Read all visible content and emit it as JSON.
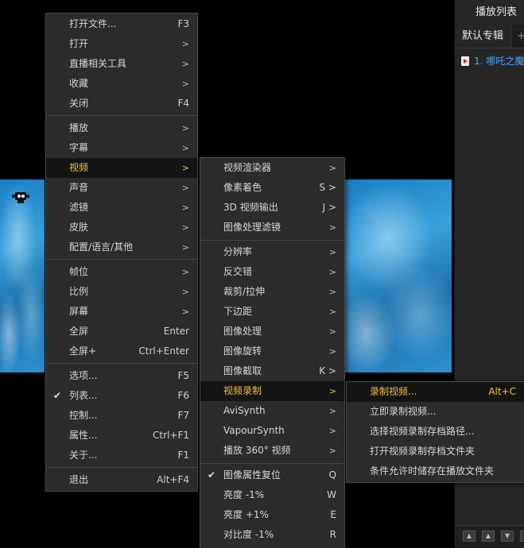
{
  "playlist": {
    "title": "播放列表",
    "tab_default": "默认专辑",
    "tab_add": "+",
    "item": "1. 哪吒之魔",
    "footer_buttons": [
      "top-arrow-icon",
      "up-arrow-icon",
      "down-arrow-icon",
      "bottom-arrow-icon"
    ]
  },
  "main_menu": [
    {
      "label": "打开文件...",
      "shortcut": "F3",
      "sub": false
    },
    {
      "label": "打开",
      "shortcut": ">",
      "sub": true
    },
    {
      "label": "直播相关工具",
      "shortcut": ">",
      "sub": true
    },
    {
      "label": "收藏",
      "shortcut": ">",
      "sub": true
    },
    {
      "label": "关闭",
      "shortcut": "F4",
      "sub": false
    },
    {
      "label": "播放",
      "shortcut": ">",
      "sub": true
    },
    {
      "label": "字幕",
      "shortcut": ">",
      "sub": true
    },
    {
      "label": "视频",
      "shortcut": ">",
      "sub": true
    },
    {
      "label": "声音",
      "shortcut": ">",
      "sub": true
    },
    {
      "label": "滤镜",
      "shortcut": ">",
      "sub": true
    },
    {
      "label": "皮肤",
      "shortcut": ">",
      "sub": true
    },
    {
      "label": "配置/语言/其他",
      "shortcut": ">",
      "sub": true
    },
    {
      "label": "帧位",
      "shortcut": ">",
      "sub": true
    },
    {
      "label": "比例",
      "shortcut": ">",
      "sub": true
    },
    {
      "label": "屏幕",
      "shortcut": ">",
      "sub": true
    },
    {
      "label": "全屏",
      "shortcut": "Enter",
      "sub": false
    },
    {
      "label": "全屏+",
      "shortcut": "Ctrl+Enter",
      "sub": false
    },
    {
      "label": "选项...",
      "shortcut": "F5",
      "sub": false
    },
    {
      "label": "列表...",
      "shortcut": "F6",
      "sub": false,
      "checked": true
    },
    {
      "label": "控制...",
      "shortcut": "F7",
      "sub": false
    },
    {
      "label": "属性...",
      "shortcut": "Ctrl+F1",
      "sub": false
    },
    {
      "label": "关于...",
      "shortcut": "F1",
      "sub": false
    },
    {
      "label": "退出",
      "shortcut": "Alt+F4",
      "sub": false
    }
  ],
  "video_menu": [
    {
      "label": "视频渲染器",
      "shortcut": ">"
    },
    {
      "label": "像素着色",
      "shortcut": "S >"
    },
    {
      "label": "3D 视频输出",
      "shortcut": "J >"
    },
    {
      "label": "图像处理滤镜",
      "shortcut": ">"
    },
    {
      "label": "分辨率",
      "shortcut": ">"
    },
    {
      "label": "反交错",
      "shortcut": ">"
    },
    {
      "label": "裁剪/拉伸",
      "shortcut": ">"
    },
    {
      "label": "下边距",
      "shortcut": ">"
    },
    {
      "label": "图像处理",
      "shortcut": ">"
    },
    {
      "label": "图像旋转",
      "shortcut": ">"
    },
    {
      "label": "图像截取",
      "shortcut": "K >"
    },
    {
      "label": "视频录制",
      "shortcut": ">"
    },
    {
      "label": "AviSynth",
      "shortcut": ">"
    },
    {
      "label": "VapourSynth",
      "shortcut": ">"
    },
    {
      "label": "播放 360° 视频",
      "shortcut": ">"
    },
    {
      "label": "图像属性复位",
      "shortcut": "Q",
      "checked": true
    },
    {
      "label": "亮度 -1%",
      "shortcut": "W"
    },
    {
      "label": "亮度 +1%",
      "shortcut": "E"
    },
    {
      "label": "对比度 -1%",
      "shortcut": "R"
    }
  ],
  "record_menu": [
    {
      "label": "录制视频...",
      "shortcut": "Alt+C"
    },
    {
      "label": "立即录制视频...",
      "shortcut": ""
    },
    {
      "label": "选择视频录制存档路径...",
      "shortcut": ""
    },
    {
      "label": "打开视频录制存档文件夹",
      "shortcut": ""
    },
    {
      "label": "条件允许时储存在播放文件夹",
      "shortcut": ""
    }
  ],
  "highlight_color": "#f0c23a"
}
